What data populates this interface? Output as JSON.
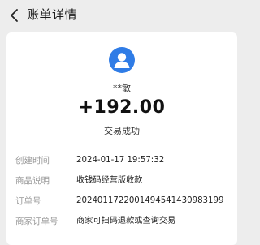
{
  "header": {
    "title": "账单详情"
  },
  "payer": {
    "name": "**敏"
  },
  "transaction": {
    "amount": "+192.00",
    "status": "交易成功"
  },
  "details": [
    {
      "label": "创建时间",
      "value": "2024-01-17 19:57:32"
    },
    {
      "label": "商品说明",
      "value": "收钱码经营版收款"
    },
    {
      "label": "订单号",
      "value": "2024011722001494541430983199"
    },
    {
      "label": "商家订单号",
      "value": "商家可扫码退款或查询交易"
    }
  ],
  "colors": {
    "accent": "#2f7ce6",
    "background": "#ededed",
    "card": "#ffffff"
  },
  "icons": {
    "back": "chevron-left-icon",
    "avatar": "user-avatar-icon"
  }
}
